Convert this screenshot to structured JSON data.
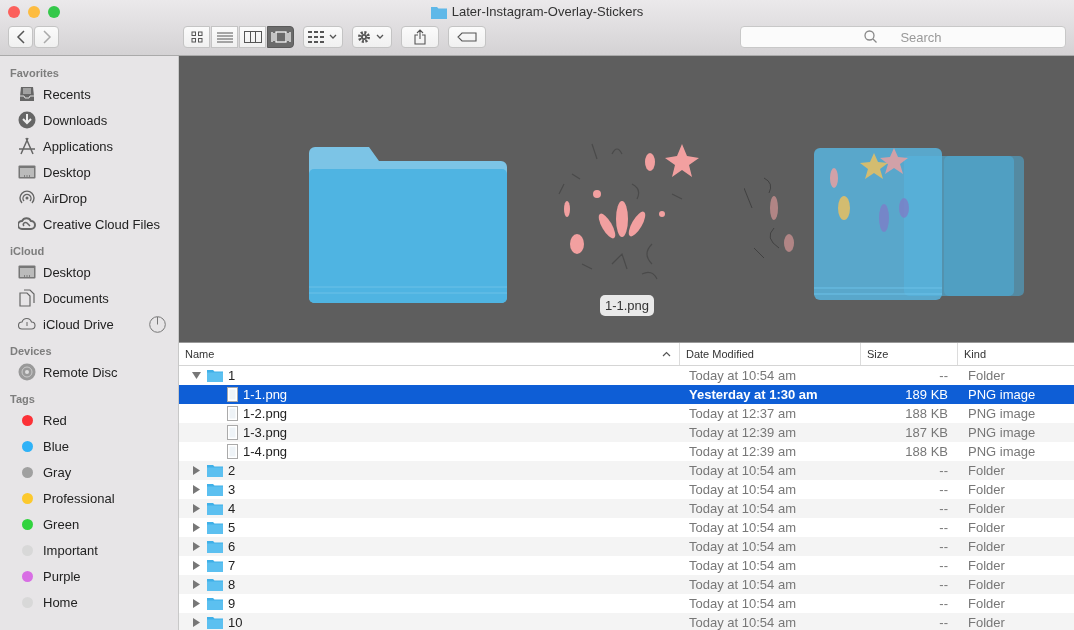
{
  "window": {
    "title": "Later-Instagram-Overlay-Stickers"
  },
  "toolbar": {
    "views": [
      {
        "kind": "icons",
        "selected": false
      },
      {
        "kind": "list",
        "selected": false
      },
      {
        "kind": "columns",
        "selected": false
      },
      {
        "kind": "coverflow",
        "selected": true
      }
    ]
  },
  "search": {
    "placeholder": "Search"
  },
  "sidebar": {
    "sections": [
      {
        "title": "Favorites",
        "items": [
          {
            "label": "Recents",
            "kind": "recents"
          },
          {
            "label": "Downloads",
            "kind": "downloads"
          },
          {
            "label": "Applications",
            "kind": "applications"
          },
          {
            "label": "Desktop",
            "kind": "desktop"
          },
          {
            "label": "AirDrop",
            "kind": "airdrop"
          },
          {
            "label": "Creative Cloud Files",
            "kind": "creative-cloud"
          }
        ]
      },
      {
        "title": "iCloud",
        "items": [
          {
            "label": "Desktop",
            "kind": "desktop"
          },
          {
            "label": "Documents",
            "kind": "documents"
          },
          {
            "label": "iCloud Drive",
            "kind": "cloud",
            "syncing": true
          }
        ]
      },
      {
        "title": "Devices",
        "items": [
          {
            "label": "Remote Disc",
            "kind": "disc"
          }
        ]
      },
      {
        "title": "Tags",
        "items": [
          {
            "label": "Red",
            "kind": "tag",
            "color": "#fc3137"
          },
          {
            "label": "Blue",
            "kind": "tag",
            "color": "#2fb2f7"
          },
          {
            "label": "Gray",
            "kind": "tag",
            "color": "#a0a0a0"
          },
          {
            "label": "Professional",
            "kind": "tag",
            "color": "#fcc92d"
          },
          {
            "label": "Green",
            "kind": "tag",
            "color": "#31d33e"
          },
          {
            "label": "Important",
            "kind": "tag",
            "color": "#d8d8d8"
          },
          {
            "label": "Purple",
            "kind": "tag",
            "color": "#d86ee4"
          },
          {
            "label": "Home",
            "kind": "tag",
            "color": "#d8d8d8"
          }
        ]
      }
    ]
  },
  "preview": {
    "caption": "1-1.png"
  },
  "list": {
    "columns": [
      {
        "label": "Name",
        "sorted": true
      },
      {
        "label": "Date Modified",
        "sorted": false
      },
      {
        "label": "Size",
        "sorted": false
      },
      {
        "label": "Kind",
        "sorted": false
      }
    ],
    "rows": [
      {
        "name": "1",
        "kind": "folder",
        "expanded": true,
        "selected": false,
        "date": "Today at 10:54 am",
        "size": "--",
        "type": "Folder",
        "children": [
          {
            "name": "1-1.png",
            "kind": "file",
            "selected": true,
            "date": "Yesterday at 1:30 am",
            "size": "189 KB",
            "type": "PNG image"
          },
          {
            "name": "1-2.png",
            "kind": "file",
            "selected": false,
            "date": "Today at 12:37 am",
            "size": "188 KB",
            "type": "PNG image"
          },
          {
            "name": "1-3.png",
            "kind": "file",
            "selected": false,
            "date": "Today at 12:39 am",
            "size": "187 KB",
            "type": "PNG image"
          },
          {
            "name": "1-4.png",
            "kind": "file",
            "selected": false,
            "date": "Today at 12:39 am",
            "size": "188 KB",
            "type": "PNG image"
          }
        ]
      },
      {
        "name": "2",
        "kind": "folder",
        "expanded": false,
        "selected": false,
        "date": "Today at 10:54 am",
        "size": "--",
        "type": "Folder"
      },
      {
        "name": "3",
        "kind": "folder",
        "expanded": false,
        "selected": false,
        "date": "Today at 10:54 am",
        "size": "--",
        "type": "Folder"
      },
      {
        "name": "4",
        "kind": "folder",
        "expanded": false,
        "selected": false,
        "date": "Today at 10:54 am",
        "size": "--",
        "type": "Folder"
      },
      {
        "name": "5",
        "kind": "folder",
        "expanded": false,
        "selected": false,
        "date": "Today at 10:54 am",
        "size": "--",
        "type": "Folder"
      },
      {
        "name": "6",
        "kind": "folder",
        "expanded": false,
        "selected": false,
        "date": "Today at 10:54 am",
        "size": "--",
        "type": "Folder"
      },
      {
        "name": "7",
        "kind": "folder",
        "expanded": false,
        "selected": false,
        "date": "Today at 10:54 am",
        "size": "--",
        "type": "Folder"
      },
      {
        "name": "8",
        "kind": "folder",
        "expanded": false,
        "selected": false,
        "date": "Today at 10:54 am",
        "size": "--",
        "type": "Folder"
      },
      {
        "name": "9",
        "kind": "folder",
        "expanded": false,
        "selected": false,
        "date": "Today at 10:54 am",
        "size": "--",
        "type": "Folder"
      },
      {
        "name": "10",
        "kind": "folder",
        "expanded": false,
        "selected": false,
        "date": "Today at 10:54 am",
        "size": "--",
        "type": "Folder"
      }
    ]
  }
}
